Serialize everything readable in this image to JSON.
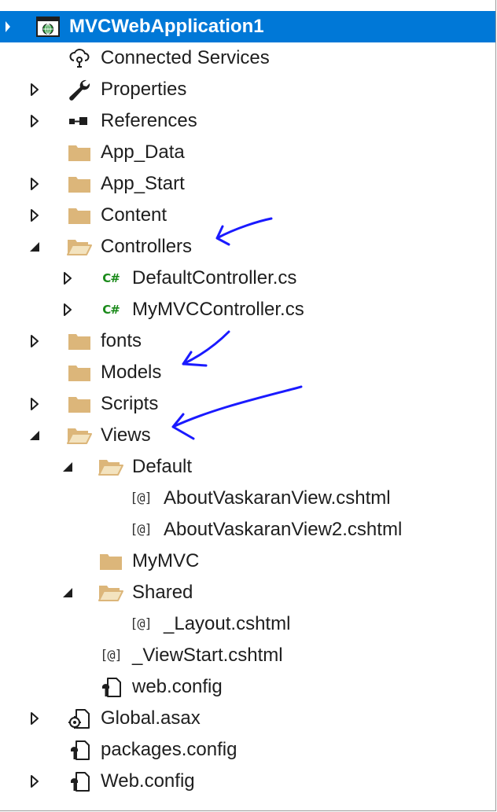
{
  "project": {
    "name": "MVCWebApplication1",
    "icon": "web-project-icon"
  },
  "items": [
    {
      "label": "Connected Services",
      "icon": "connected-services-icon",
      "expander": "none"
    },
    {
      "label": "Properties",
      "icon": "wrench-icon",
      "expander": "collapsed"
    },
    {
      "label": "References",
      "icon": "references-icon",
      "expander": "collapsed"
    },
    {
      "label": "App_Data",
      "icon": "folder-icon",
      "expander": "none"
    },
    {
      "label": "App_Start",
      "icon": "folder-icon",
      "expander": "collapsed"
    },
    {
      "label": "Content",
      "icon": "folder-icon",
      "expander": "collapsed"
    },
    {
      "label": "Controllers",
      "icon": "open-folder-icon",
      "expander": "expanded"
    },
    {
      "label": "DefaultController.cs",
      "icon": "csharp-file-icon",
      "expander": "collapsed"
    },
    {
      "label": "MyMVCController.cs",
      "icon": "csharp-file-icon",
      "expander": "collapsed"
    },
    {
      "label": "fonts",
      "icon": "folder-icon",
      "expander": "collapsed"
    },
    {
      "label": "Models",
      "icon": "folder-icon",
      "expander": "none"
    },
    {
      "label": "Scripts",
      "icon": "folder-icon",
      "expander": "collapsed"
    },
    {
      "label": "Views",
      "icon": "open-folder-icon",
      "expander": "expanded"
    },
    {
      "label": "Default",
      "icon": "open-folder-icon",
      "expander": "expanded"
    },
    {
      "label": "AboutVaskaranView.cshtml",
      "icon": "razor-file-icon",
      "expander": "none"
    },
    {
      "label": "AboutVaskaranView2.cshtml",
      "icon": "razor-file-icon",
      "expander": "none"
    },
    {
      "label": "MyMVC",
      "icon": "folder-icon",
      "expander": "none"
    },
    {
      "label": "Shared",
      "icon": "open-folder-icon",
      "expander": "expanded"
    },
    {
      "label": "_Layout.cshtml",
      "icon": "razor-file-icon",
      "expander": "none"
    },
    {
      "label": "_ViewStart.cshtml",
      "icon": "razor-file-icon",
      "expander": "none"
    },
    {
      "label": "web.config",
      "icon": "config-file-icon",
      "expander": "none"
    },
    {
      "label": "Global.asax",
      "icon": "global-asax-icon",
      "expander": "collapsed"
    },
    {
      "label": "packages.config",
      "icon": "config-file-icon",
      "expander": "none"
    },
    {
      "label": "Web.config",
      "icon": "config-file-icon",
      "expander": "collapsed"
    }
  ],
  "razor_glyph": "[@]",
  "csharp_glyph": "C#",
  "colors": {
    "selection": "#0078d7",
    "folder": "#dcb67a",
    "annotation_arrow": "#1a1aff"
  }
}
